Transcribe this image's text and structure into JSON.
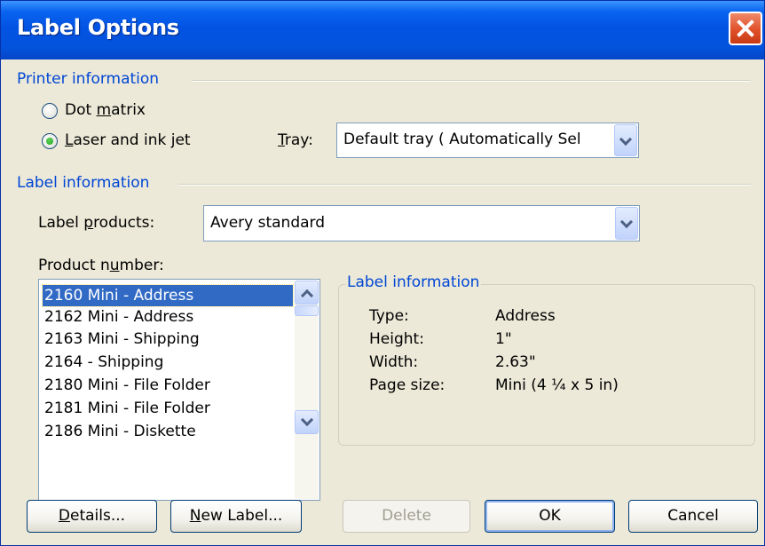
{
  "window": {
    "title": "Label Options"
  },
  "printer_info": {
    "group_title": "Printer information",
    "dot_matrix": {
      "label_pre": "Dot ",
      "label_acc": "m",
      "label_post": "atrix",
      "checked": false
    },
    "laser": {
      "label_pre": "",
      "label_acc": "L",
      "label_post": "aser and ink jet",
      "checked": true
    },
    "tray": {
      "label_pre": "",
      "label_acc": "T",
      "label_post": "ray:",
      "value": "Default tray ( Automatically Sel"
    }
  },
  "label_info": {
    "group_title": "Label information",
    "label_products": {
      "label_pre": "Label ",
      "label_acc": "p",
      "label_post": "roducts:",
      "value": "Avery standard"
    },
    "product_number": {
      "label_pre": "Product n",
      "label_acc": "u",
      "label_post": "mber:"
    },
    "products": [
      "2160 Mini - Address",
      "2162 Mini - Address",
      "2163 Mini - Shipping",
      "2164 - Shipping",
      "2180 Mini - File Folder",
      "2181 Mini - File Folder",
      "2186 Mini - Diskette"
    ],
    "selected_product": "2160 Mini - Address"
  },
  "details_panel": {
    "title": "Label information",
    "rows": [
      {
        "label": "Type:",
        "value": "Address"
      },
      {
        "label": "Height:",
        "value": "1\""
      },
      {
        "label": "Width:",
        "value": "2.63\""
      },
      {
        "label": "Page size:",
        "value": "Mini (4 ¼ x 5 in)"
      }
    ]
  },
  "buttons": {
    "details": {
      "label_pre": "",
      "label_acc": "D",
      "label_post": "etails..."
    },
    "new_label": {
      "label_pre": "",
      "label_acc": "N",
      "label_post": "ew Label..."
    },
    "delete": "Delete",
    "ok": "OK",
    "cancel": "Cancel"
  },
  "icons": {
    "close": "close-icon",
    "dropdown": "chevron-down-icon",
    "scroll_up": "chevron-up-icon",
    "scroll_down": "chevron-down-icon"
  },
  "colors": {
    "titlebar": "#0453dc",
    "dialog_bg": "#ece9d8",
    "group_title": "#0046d5",
    "selection": "#316ac5",
    "close_button": "#e0502a"
  }
}
